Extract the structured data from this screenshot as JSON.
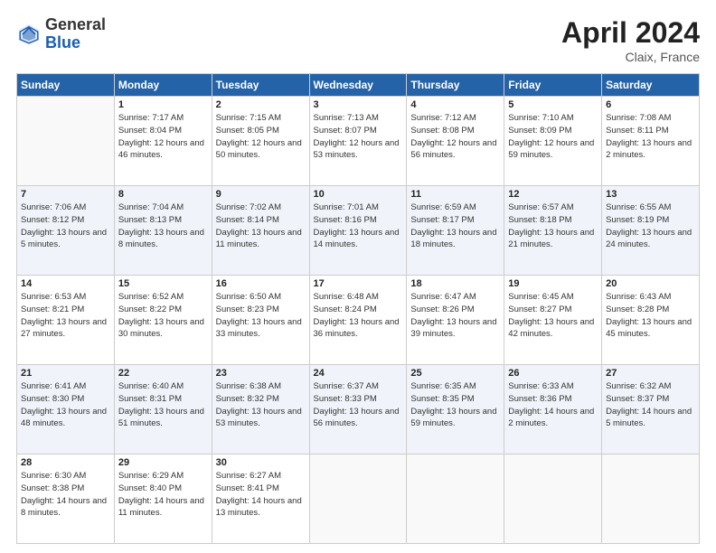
{
  "header": {
    "logo_general": "General",
    "logo_blue": "Blue",
    "month_year": "April 2024",
    "location": "Claix, France"
  },
  "days_of_week": [
    "Sunday",
    "Monday",
    "Tuesday",
    "Wednesday",
    "Thursday",
    "Friday",
    "Saturday"
  ],
  "weeks": [
    [
      {
        "day": "",
        "sunrise": "",
        "sunset": "",
        "daylight": ""
      },
      {
        "day": "1",
        "sunrise": "Sunrise: 7:17 AM",
        "sunset": "Sunset: 8:04 PM",
        "daylight": "Daylight: 12 hours and 46 minutes."
      },
      {
        "day": "2",
        "sunrise": "Sunrise: 7:15 AM",
        "sunset": "Sunset: 8:05 PM",
        "daylight": "Daylight: 12 hours and 50 minutes."
      },
      {
        "day": "3",
        "sunrise": "Sunrise: 7:13 AM",
        "sunset": "Sunset: 8:07 PM",
        "daylight": "Daylight: 12 hours and 53 minutes."
      },
      {
        "day": "4",
        "sunrise": "Sunrise: 7:12 AM",
        "sunset": "Sunset: 8:08 PM",
        "daylight": "Daylight: 12 hours and 56 minutes."
      },
      {
        "day": "5",
        "sunrise": "Sunrise: 7:10 AM",
        "sunset": "Sunset: 8:09 PM",
        "daylight": "Daylight: 12 hours and 59 minutes."
      },
      {
        "day": "6",
        "sunrise": "Sunrise: 7:08 AM",
        "sunset": "Sunset: 8:11 PM",
        "daylight": "Daylight: 13 hours and 2 minutes."
      }
    ],
    [
      {
        "day": "7",
        "sunrise": "Sunrise: 7:06 AM",
        "sunset": "Sunset: 8:12 PM",
        "daylight": "Daylight: 13 hours and 5 minutes."
      },
      {
        "day": "8",
        "sunrise": "Sunrise: 7:04 AM",
        "sunset": "Sunset: 8:13 PM",
        "daylight": "Daylight: 13 hours and 8 minutes."
      },
      {
        "day": "9",
        "sunrise": "Sunrise: 7:02 AM",
        "sunset": "Sunset: 8:14 PM",
        "daylight": "Daylight: 13 hours and 11 minutes."
      },
      {
        "day": "10",
        "sunrise": "Sunrise: 7:01 AM",
        "sunset": "Sunset: 8:16 PM",
        "daylight": "Daylight: 13 hours and 14 minutes."
      },
      {
        "day": "11",
        "sunrise": "Sunrise: 6:59 AM",
        "sunset": "Sunset: 8:17 PM",
        "daylight": "Daylight: 13 hours and 18 minutes."
      },
      {
        "day": "12",
        "sunrise": "Sunrise: 6:57 AM",
        "sunset": "Sunset: 8:18 PM",
        "daylight": "Daylight: 13 hours and 21 minutes."
      },
      {
        "day": "13",
        "sunrise": "Sunrise: 6:55 AM",
        "sunset": "Sunset: 8:19 PM",
        "daylight": "Daylight: 13 hours and 24 minutes."
      }
    ],
    [
      {
        "day": "14",
        "sunrise": "Sunrise: 6:53 AM",
        "sunset": "Sunset: 8:21 PM",
        "daylight": "Daylight: 13 hours and 27 minutes."
      },
      {
        "day": "15",
        "sunrise": "Sunrise: 6:52 AM",
        "sunset": "Sunset: 8:22 PM",
        "daylight": "Daylight: 13 hours and 30 minutes."
      },
      {
        "day": "16",
        "sunrise": "Sunrise: 6:50 AM",
        "sunset": "Sunset: 8:23 PM",
        "daylight": "Daylight: 13 hours and 33 minutes."
      },
      {
        "day": "17",
        "sunrise": "Sunrise: 6:48 AM",
        "sunset": "Sunset: 8:24 PM",
        "daylight": "Daylight: 13 hours and 36 minutes."
      },
      {
        "day": "18",
        "sunrise": "Sunrise: 6:47 AM",
        "sunset": "Sunset: 8:26 PM",
        "daylight": "Daylight: 13 hours and 39 minutes."
      },
      {
        "day": "19",
        "sunrise": "Sunrise: 6:45 AM",
        "sunset": "Sunset: 8:27 PM",
        "daylight": "Daylight: 13 hours and 42 minutes."
      },
      {
        "day": "20",
        "sunrise": "Sunrise: 6:43 AM",
        "sunset": "Sunset: 8:28 PM",
        "daylight": "Daylight: 13 hours and 45 minutes."
      }
    ],
    [
      {
        "day": "21",
        "sunrise": "Sunrise: 6:41 AM",
        "sunset": "Sunset: 8:30 PM",
        "daylight": "Daylight: 13 hours and 48 minutes."
      },
      {
        "day": "22",
        "sunrise": "Sunrise: 6:40 AM",
        "sunset": "Sunset: 8:31 PM",
        "daylight": "Daylight: 13 hours and 51 minutes."
      },
      {
        "day": "23",
        "sunrise": "Sunrise: 6:38 AM",
        "sunset": "Sunset: 8:32 PM",
        "daylight": "Daylight: 13 hours and 53 minutes."
      },
      {
        "day": "24",
        "sunrise": "Sunrise: 6:37 AM",
        "sunset": "Sunset: 8:33 PM",
        "daylight": "Daylight: 13 hours and 56 minutes."
      },
      {
        "day": "25",
        "sunrise": "Sunrise: 6:35 AM",
        "sunset": "Sunset: 8:35 PM",
        "daylight": "Daylight: 13 hours and 59 minutes."
      },
      {
        "day": "26",
        "sunrise": "Sunrise: 6:33 AM",
        "sunset": "Sunset: 8:36 PM",
        "daylight": "Daylight: 14 hours and 2 minutes."
      },
      {
        "day": "27",
        "sunrise": "Sunrise: 6:32 AM",
        "sunset": "Sunset: 8:37 PM",
        "daylight": "Daylight: 14 hours and 5 minutes."
      }
    ],
    [
      {
        "day": "28",
        "sunrise": "Sunrise: 6:30 AM",
        "sunset": "Sunset: 8:38 PM",
        "daylight": "Daylight: 14 hours and 8 minutes."
      },
      {
        "day": "29",
        "sunrise": "Sunrise: 6:29 AM",
        "sunset": "Sunset: 8:40 PM",
        "daylight": "Daylight: 14 hours and 11 minutes."
      },
      {
        "day": "30",
        "sunrise": "Sunrise: 6:27 AM",
        "sunset": "Sunset: 8:41 PM",
        "daylight": "Daylight: 14 hours and 13 minutes."
      },
      {
        "day": "",
        "sunrise": "",
        "sunset": "",
        "daylight": ""
      },
      {
        "day": "",
        "sunrise": "",
        "sunset": "",
        "daylight": ""
      },
      {
        "day": "",
        "sunrise": "",
        "sunset": "",
        "daylight": ""
      },
      {
        "day": "",
        "sunrise": "",
        "sunset": "",
        "daylight": ""
      }
    ]
  ]
}
